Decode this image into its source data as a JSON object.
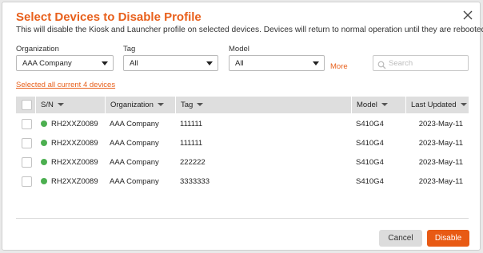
{
  "dialog": {
    "title": "Select Devices to Disable Profile",
    "subtitle": "This will disable the Kiosk and Launcher profile on selected devices. Devices will return to normal operation until they are rebooted.",
    "close_icon": "close-icon"
  },
  "filters": {
    "organization": {
      "label": "Organization",
      "value": "AAA Company"
    },
    "tag": {
      "label": "Tag",
      "value": "All"
    },
    "model": {
      "label": "Model",
      "value": "All"
    },
    "more_label": "More",
    "search_placeholder": "Search",
    "search_icon": "search-icon"
  },
  "select_all_link": "Selected all current 4 devices",
  "table": {
    "columns": [
      "S/N",
      "Organization",
      "Tag",
      "Model",
      "Last Updated"
    ],
    "rows": [
      {
        "sn": "RH2XXZ0089",
        "organization": "AAA Company",
        "tag": "111111",
        "model": "S410G4",
        "last_updated": "2023-May-11",
        "status": "online"
      },
      {
        "sn": "RH2XXZ0089",
        "organization": "AAA Company",
        "tag": "111111",
        "model": "S410G4",
        "last_updated": "2023-May-11",
        "status": "online"
      },
      {
        "sn": "RH2XXZ0089",
        "organization": "AAA Company",
        "tag": "222222",
        "model": "S410G4",
        "last_updated": "2023-May-11",
        "status": "online"
      },
      {
        "sn": "RH2XXZ0089",
        "organization": "AAA Company",
        "tag": "3333333",
        "model": "S410G4",
        "last_updated": "2023-May-11",
        "status": "online"
      }
    ]
  },
  "buttons": {
    "cancel": "Cancel",
    "disable": "Disable"
  },
  "colors": {
    "accent": "#e8601c",
    "status_online": "#4caf50",
    "header_bg": "#dedede"
  }
}
